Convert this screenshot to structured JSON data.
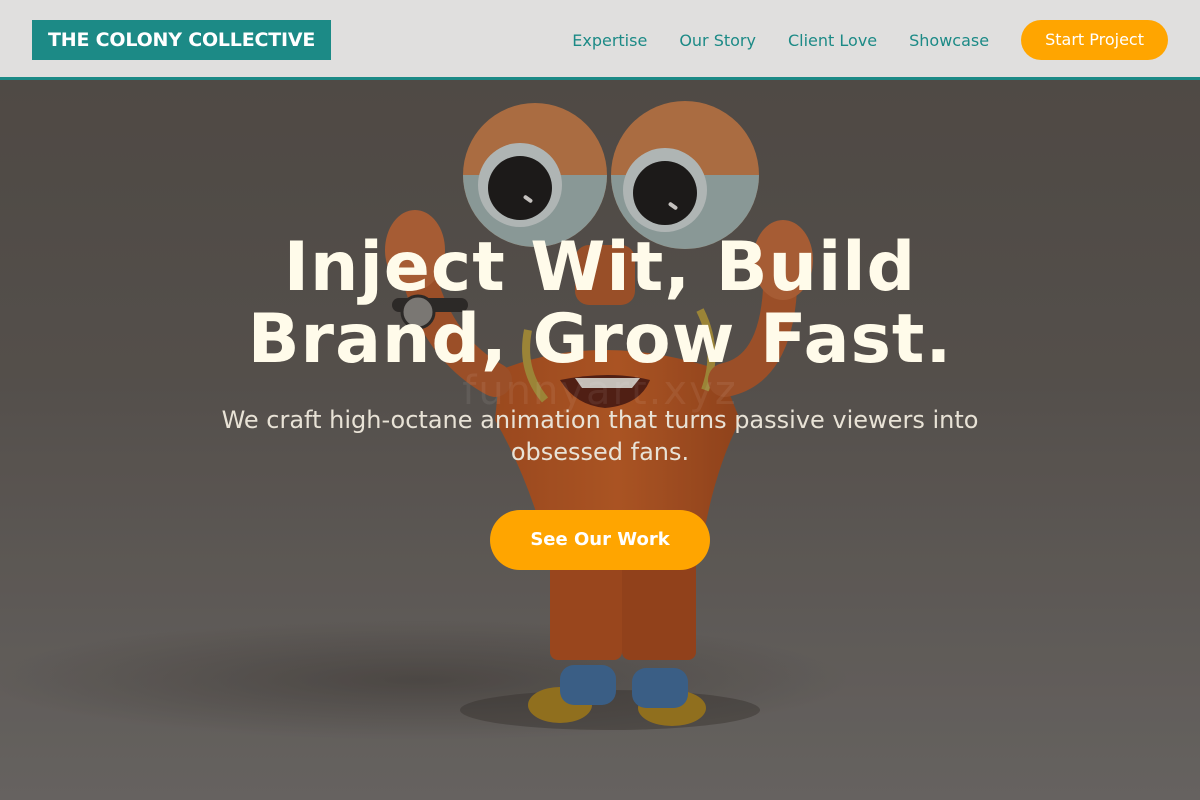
{
  "header": {
    "logo": "THE COLONY COLLECTIVE",
    "nav": [
      "Expertise",
      "Our Story",
      "Client Love",
      "Showcase"
    ],
    "cta": "Start Project"
  },
  "hero": {
    "title_line1": "Inject Wit, Build",
    "title_line2": "Brand, Grow Fast.",
    "subtitle": "We craft high-octane animation that turns passive viewers into obsessed fans.",
    "cta": "See Our Work",
    "watermark": "funnyart.xyz",
    "background_image": "orange-cartoon-character-waving"
  },
  "colors": {
    "brand": "#1c8a86",
    "accent": "#ffa500",
    "header_bg": "#e0dfde",
    "hero_text": "#fffbea"
  }
}
